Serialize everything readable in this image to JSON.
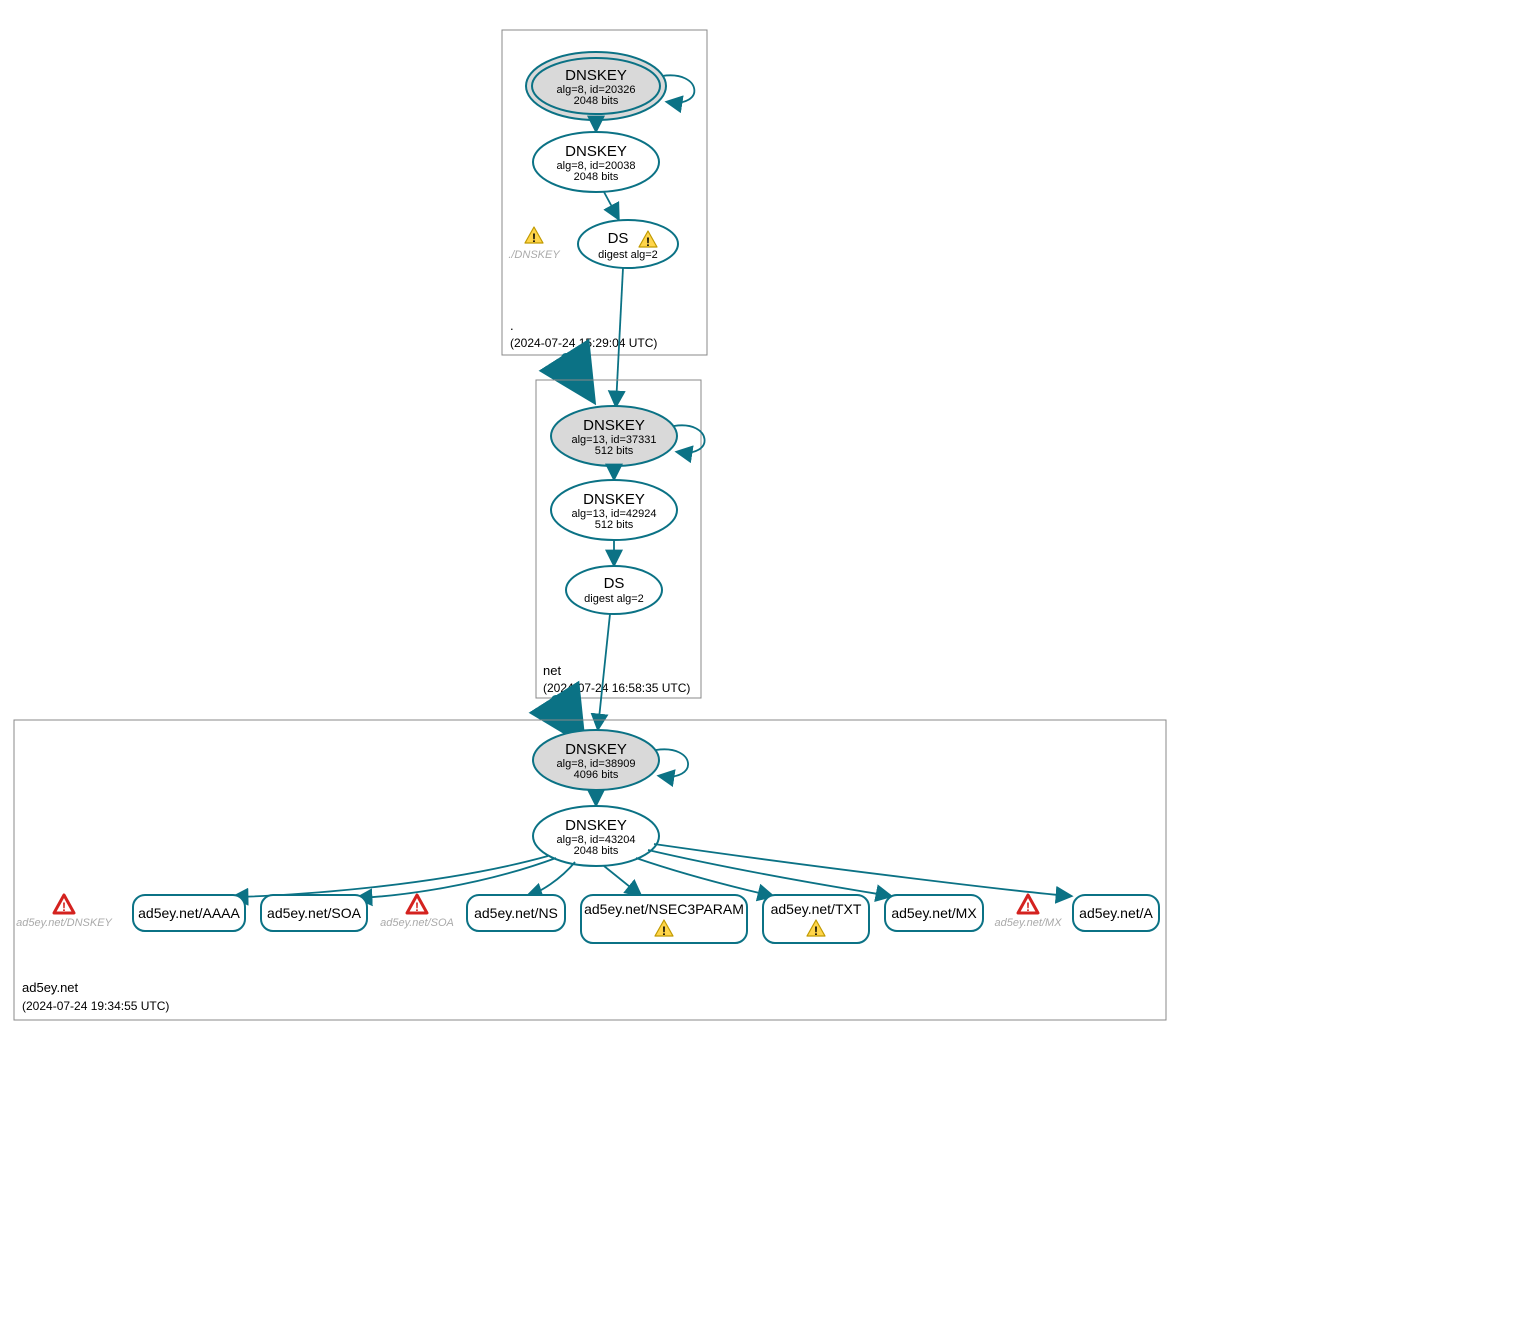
{
  "zones": {
    "root": {
      "name": ".",
      "timestamp": "(2024-07-24 15:29:04 UTC)"
    },
    "net": {
      "name": "net",
      "timestamp": "(2024-07-24 16:58:35 UTC)"
    },
    "domain": {
      "name": "ad5ey.net",
      "timestamp": "(2024-07-24 19:34:55 UTC)"
    }
  },
  "nodes": {
    "root_ksk": {
      "title": "DNSKEY",
      "line1": "alg=8, id=20326",
      "line2": "2048 bits"
    },
    "root_zsk": {
      "title": "DNSKEY",
      "line1": "alg=8, id=20038",
      "line2": "2048 bits"
    },
    "root_ds": {
      "title": "DS",
      "line1": "digest alg=2"
    },
    "root_ghost": {
      "label": "./DNSKEY"
    },
    "net_ksk": {
      "title": "DNSKEY",
      "line1": "alg=13, id=37331",
      "line2": "512 bits"
    },
    "net_zsk": {
      "title": "DNSKEY",
      "line1": "alg=13, id=42924",
      "line2": "512 bits"
    },
    "net_ds": {
      "title": "DS",
      "line1": "digest alg=2"
    },
    "dom_ksk": {
      "title": "DNSKEY",
      "line1": "alg=8, id=38909",
      "line2": "4096 bits"
    },
    "dom_zsk": {
      "title": "DNSKEY",
      "line1": "alg=8, id=43204",
      "line2": "2048 bits"
    },
    "rr_aaaa": {
      "label": "ad5ey.net/AAAA"
    },
    "rr_soa": {
      "label": "ad5ey.net/SOA"
    },
    "rr_ns": {
      "label": "ad5ey.net/NS"
    },
    "rr_nsec3": {
      "label": "ad5ey.net/NSEC3PARAM"
    },
    "rr_txt": {
      "label": "ad5ey.net/TXT"
    },
    "rr_mx": {
      "label": "ad5ey.net/MX"
    },
    "rr_a": {
      "label": "ad5ey.net/A"
    },
    "ghost_dnskey": {
      "label": "ad5ey.net/DNSKEY"
    },
    "ghost_soa": {
      "label": "ad5ey.net/SOA"
    },
    "ghost_mx": {
      "label": "ad5ey.net/MX"
    }
  }
}
